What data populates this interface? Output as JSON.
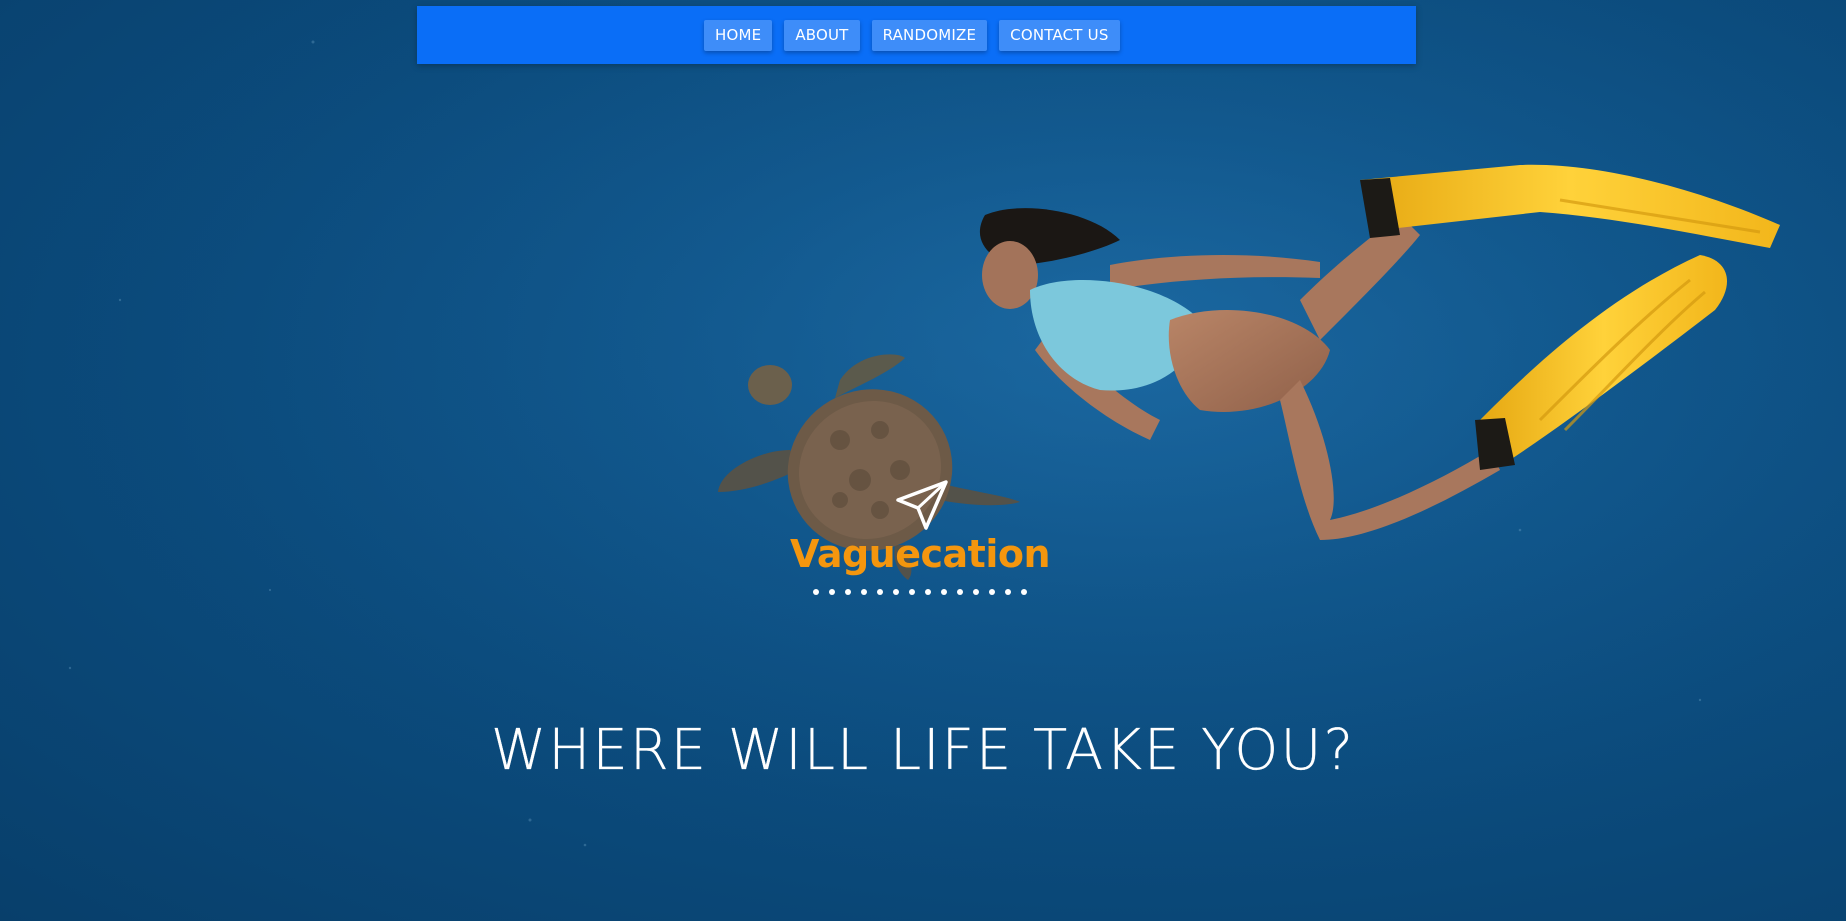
{
  "nav": {
    "items": [
      {
        "label": "HOME"
      },
      {
        "label": "ABOUT"
      },
      {
        "label": "RANDOMIZE"
      },
      {
        "label": "CONTACT US"
      }
    ]
  },
  "logo": {
    "name": "Vaguecation",
    "icon": "paper-plane-icon"
  },
  "hero": {
    "headline": "WHERE WILL LIFE TAKE YOU?"
  },
  "colors": {
    "nav_bar": "#0a6ef7",
    "nav_button": "#3e8df9",
    "logo_text": "#f4960e",
    "ocean_background": "#0b4a7b",
    "fins": "#f7c21d",
    "swimsuit": "#7cc8dc"
  }
}
